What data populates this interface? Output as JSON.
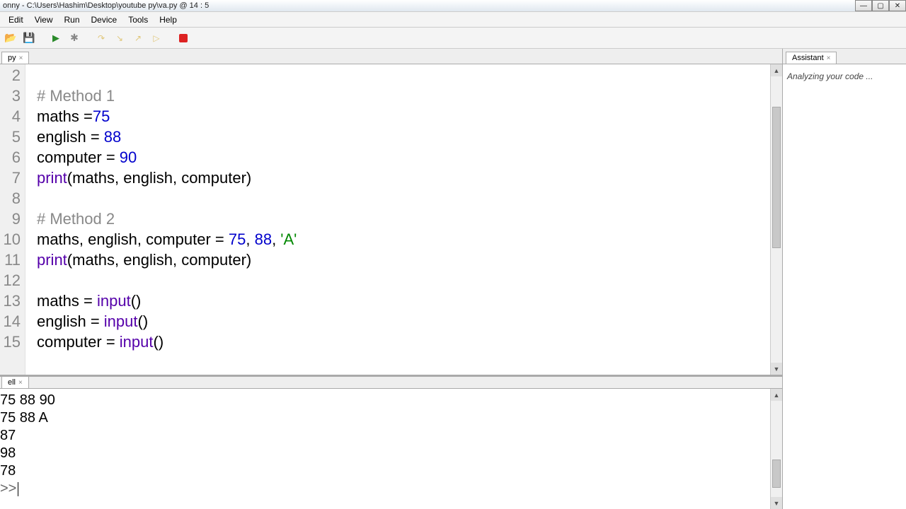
{
  "window": {
    "title": "onny  -  C:\\Users\\Hashim\\Desktop\\youtube py\\va.py  @  14 : 5"
  },
  "menu": {
    "items": [
      "Edit",
      "View",
      "Run",
      "Device",
      "Tools",
      "Help"
    ]
  },
  "editor_tab": {
    "label": "py"
  },
  "code_lines": [
    {
      "n": "2",
      "html": ""
    },
    {
      "n": "3",
      "html": "<span class='cm'># Method 1</span>"
    },
    {
      "n": "4",
      "html": "maths =<span class='num'>75</span>"
    },
    {
      "n": "5",
      "html": "english = <span class='num'>88</span>"
    },
    {
      "n": "6",
      "html": "computer = <span class='num'>90</span>"
    },
    {
      "n": "7",
      "html": "<span class='fn'>print</span>(maths, english, computer)"
    },
    {
      "n": "8",
      "html": ""
    },
    {
      "n": "9",
      "html": "<span class='cm'># Method 2</span>"
    },
    {
      "n": "10",
      "html": "maths, english, computer = <span class='num'>75</span>, <span class='num'>88</span>, <span class='str'>'A'</span>"
    },
    {
      "n": "11",
      "html": "<span class='fn'>print</span>(maths, english, computer)"
    },
    {
      "n": "12",
      "html": ""
    },
    {
      "n": "13",
      "html": "maths = <span class='fn'>input</span>()"
    },
    {
      "n": "14",
      "html": "english = <span class='fn'>input</span>()"
    },
    {
      "n": "15",
      "html": "computer = <span class='fn'>input</span>()"
    }
  ],
  "shell_tab": {
    "label": "ell"
  },
  "shell_lines": [
    "75 88 90",
    "75 88 A",
    "87",
    "98",
    "78"
  ],
  "shell_prompt": ">>",
  "assistant": {
    "tab": "Assistant",
    "message": "Analyzing your code ..."
  }
}
